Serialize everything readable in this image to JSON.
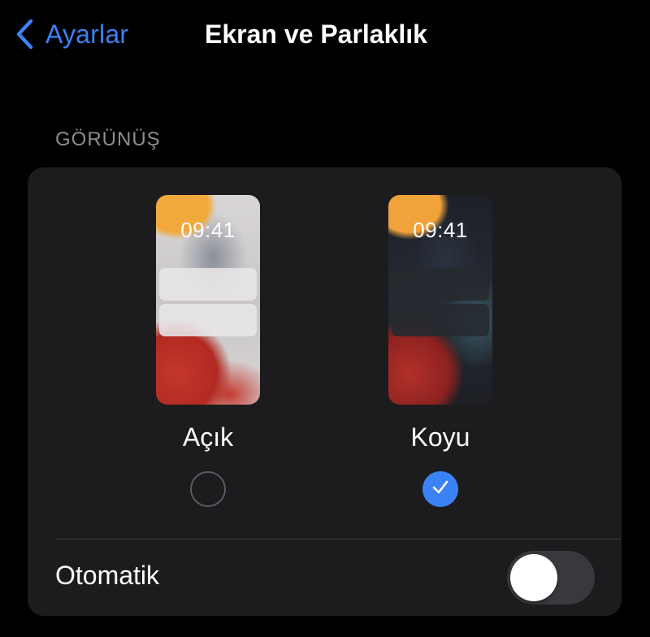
{
  "nav": {
    "back_label": "Ayarlar",
    "title": "Ekran ve Parlaklık"
  },
  "appearance": {
    "section_header": "GÖRÜNÜŞ",
    "options": [
      {
        "label": "Açık",
        "preview_time": "09:41",
        "selected": false
      },
      {
        "label": "Koyu",
        "preview_time": "09:41",
        "selected": true
      }
    ],
    "automatic": {
      "label": "Otomatik",
      "enabled": false
    }
  },
  "colors": {
    "accent": "#3b82f6",
    "background": "#000000",
    "card": "#1c1c1e",
    "secondary_text": "#8d8d93"
  },
  "icons": {
    "back": "chevron-left-icon",
    "selected": "checkmark-icon"
  }
}
